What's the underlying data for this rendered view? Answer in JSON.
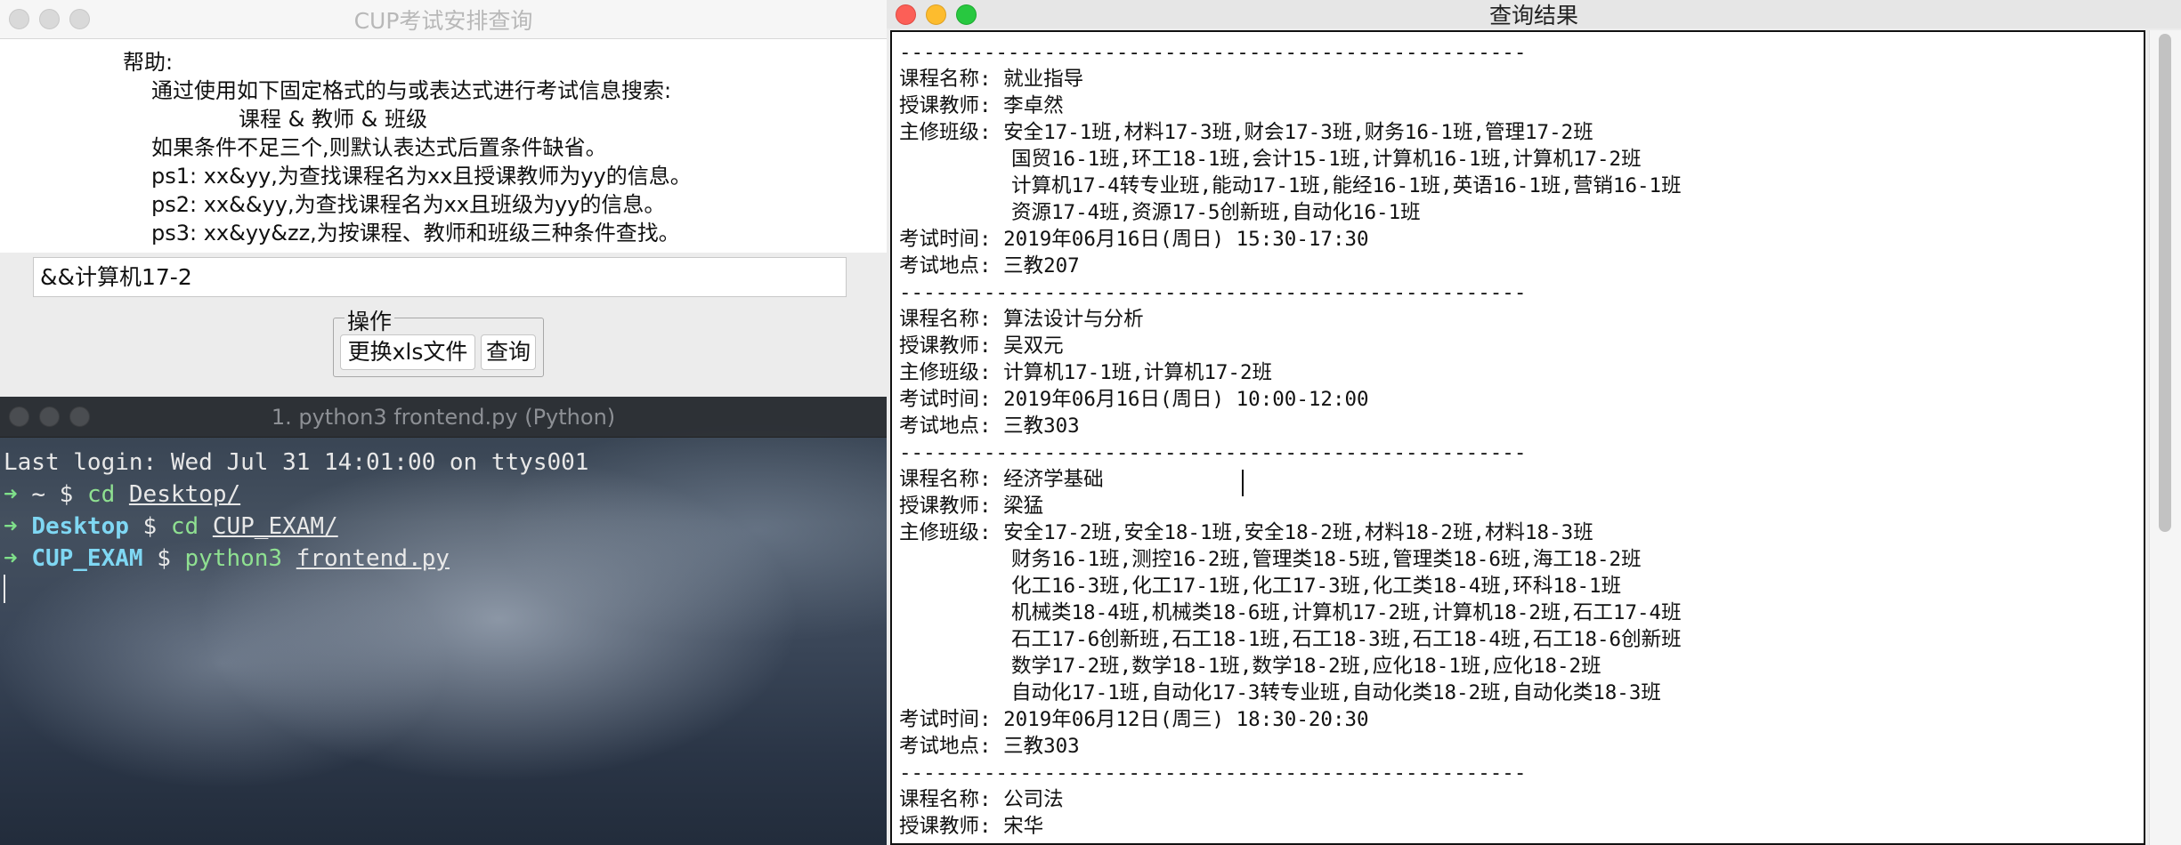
{
  "query_window": {
    "title": "CUP考试安排查询",
    "help_title": "帮助:",
    "help_lines": [
      "通过使用如下固定格式的与或表达式进行考试信息搜索:",
      "课程 & 教师 & 班级",
      "如果条件不足三个,则默认表达式后置条件缺省。",
      "ps1: xx&yy,为查找课程名为xx且授课教师为yy的信息。",
      "ps2: xx&&yy,为查找课程名为xx且班级为yy的信息。",
      "ps3: xx&yy&zz,为按课程、教师和班级三种条件查找。"
    ],
    "search_value": "&&计算机17-2",
    "ops_label": "操作",
    "change_file_button": "更换xls文件",
    "query_button": "查询"
  },
  "terminal_window": {
    "title": "1. python3 frontend.py (Python)",
    "last_login": "Last login: Wed Jul 31 14:01:00 on ttys001",
    "lines": [
      {
        "arrow": "➜",
        "dir": "~",
        "prompt": "$",
        "cmd": "cd",
        "arg": "Desktop/"
      },
      {
        "arrow": "➜",
        "dir": "Desktop",
        "prompt": "$",
        "cmd": "cd",
        "arg": "CUP_EXAM/"
      },
      {
        "arrow": "➜",
        "dir": "CUP_EXAM",
        "prompt": "$",
        "cmd": "python3",
        "arg": "frontend.py"
      }
    ]
  },
  "result_window": {
    "title": "查询结果",
    "separator": "----------------------------------------------------",
    "entries": [
      {
        "course": "课程名称: 就业指导",
        "teacher": "授课教师: 李卓然",
        "classes_first": "主修班级: 安全17-1班,材料17-3班,财会17-3班,财务16-1班,管理17-2班",
        "classes_more": [
          "国贸16-1班,环工18-1班,会计15-1班,计算机16-1班,计算机17-2班",
          "计算机17-4转专业班,能动17-1班,能经16-1班,英语16-1班,营销16-1班",
          "资源17-4班,资源17-5创新班,自动化16-1班"
        ],
        "time": "考试时间: 2019年06月16日(周日) 15:30-17:30",
        "place": "考试地点: 三教207"
      },
      {
        "course": "课程名称: 算法设计与分析",
        "teacher": "授课教师: 吴双元",
        "classes_first": "主修班级: 计算机17-1班,计算机17-2班",
        "classes_more": [],
        "time": "考试时间: 2019年06月16日(周日) 10:00-12:00",
        "place": "考试地点: 三教303"
      },
      {
        "course": "课程名称: 经济学基础",
        "teacher": "授课教师: 梁猛",
        "classes_first": "主修班级: 安全17-2班,安全18-1班,安全18-2班,材料18-2班,材料18-3班",
        "classes_more": [
          "财务16-1班,测控16-2班,管理类18-5班,管理类18-6班,海工18-2班",
          "化工16-3班,化工17-1班,化工17-3班,化工类18-4班,环科18-1班",
          "机械类18-4班,机械类18-6班,计算机17-2班,计算机18-2班,石工17-4班",
          "石工17-6创新班,石工18-1班,石工18-3班,石工18-4班,石工18-6创新班",
          "数学17-2班,数学18-1班,数学18-2班,应化18-1班,应化18-2班",
          "自动化17-1班,自动化17-3转专业班,自动化类18-2班,自动化类18-3班"
        ],
        "time": "考试时间: 2019年06月12日(周三) 18:30-20:30",
        "place": "考试地点: 三教303"
      },
      {
        "course": "课程名称: 公司法",
        "teacher": "授课教师: 宋华"
      }
    ]
  }
}
